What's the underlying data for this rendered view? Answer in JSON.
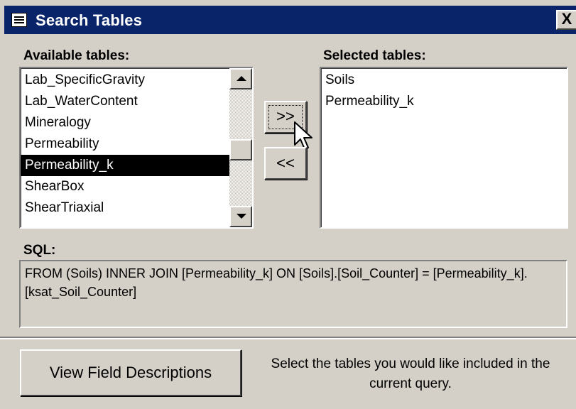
{
  "window": {
    "title": "Search Tables",
    "close_label": "X"
  },
  "available": {
    "label": "Available tables:",
    "items": [
      {
        "label": "Lab_SpecificGravity",
        "selected": false
      },
      {
        "label": "Lab_WaterContent",
        "selected": false
      },
      {
        "label": "Mineralogy",
        "selected": false
      },
      {
        "label": "Permeability",
        "selected": false
      },
      {
        "label": "Permeability_k",
        "selected": true
      },
      {
        "label": "ShearBox",
        "selected": false
      },
      {
        "label": "ShearTriaxial",
        "selected": false
      }
    ]
  },
  "buttons": {
    "add_label": ">>",
    "remove_label": "<<",
    "view_fields_label": "View Field Descriptions"
  },
  "selected": {
    "label": "Selected tables:",
    "items": [
      "Soils",
      "Permeability_k"
    ]
  },
  "sql": {
    "label": "SQL:",
    "text": "FROM (Soils) INNER JOIN [Permeability_k] ON [Soils].[Soil_Counter] = [Permeability_k].[ksat_Soil_Counter]"
  },
  "instructions": "Select the tables you would like included in the current query."
}
